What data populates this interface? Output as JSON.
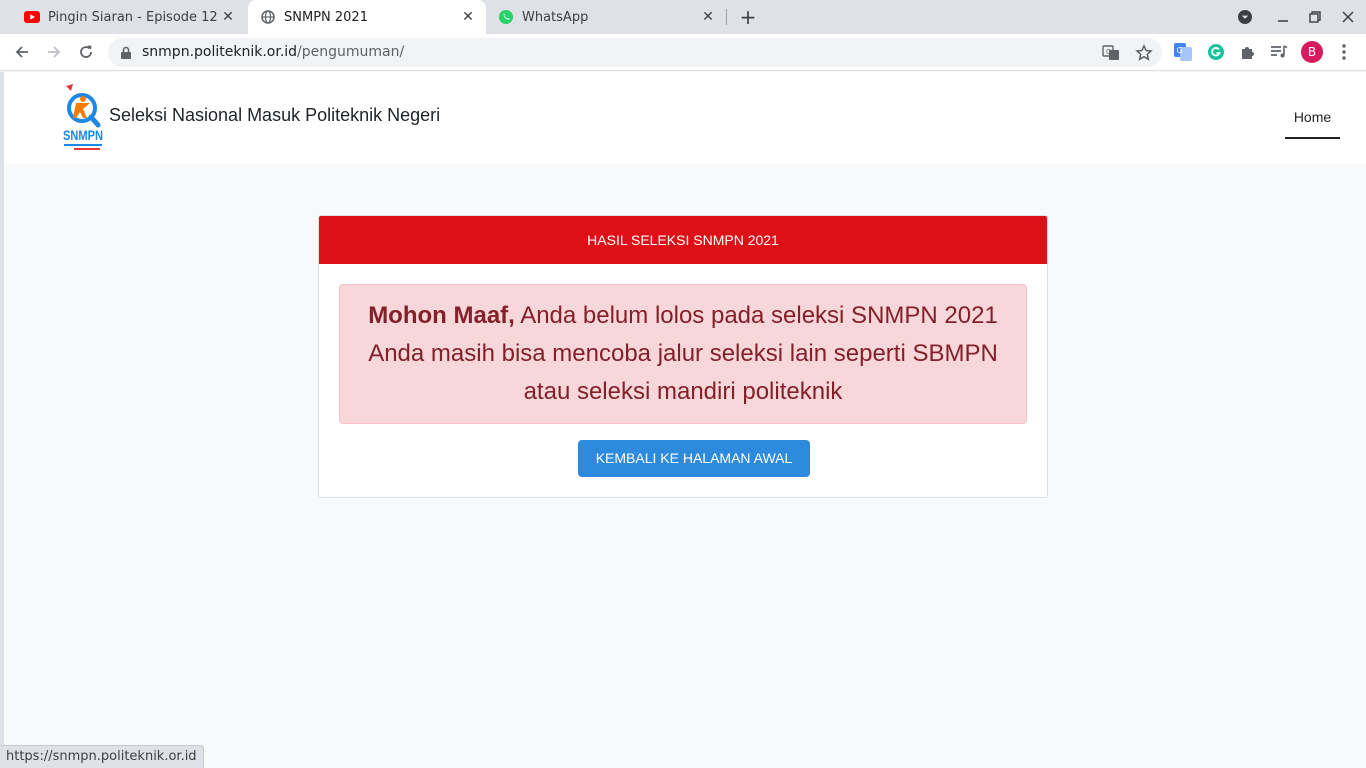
{
  "browser": {
    "tabs": [
      {
        "title": "Pingin Siaran - Episode 12 |",
        "icon": "youtube-icon",
        "active": false
      },
      {
        "title": "SNMPN 2021",
        "icon": "globe-icon",
        "active": true
      },
      {
        "title": "WhatsApp",
        "icon": "whatsapp-icon",
        "active": false
      }
    ],
    "url_host": "snmpn.politeknik.or.id",
    "url_path": "/pengumuman/",
    "profile_initial": "B",
    "status_url": "https://snmpn.politeknik.or.id"
  },
  "site": {
    "title": "Seleksi Nasional Masuk Politeknik Negeri",
    "logo_text": "SNMPN",
    "nav": {
      "home": "Home"
    }
  },
  "result": {
    "header": "HASIL SELEKSI SNMPN 2021",
    "message_bold": "Mohon Maaf,",
    "message_line1": "Anda belum lolos pada seleksi SNMPN 2021",
    "message_line2": "Anda masih bisa mencoba jalur seleksi lain seperti SBMPN",
    "message_line3": "atau seleksi mandiri politeknik",
    "back_button": "KEMBALI KE HALAMAN AWAL"
  },
  "colors": {
    "header_red": "#dc1016",
    "alert_bg": "#f8d7da",
    "alert_text": "#842029",
    "button_blue": "#2d8adc"
  }
}
